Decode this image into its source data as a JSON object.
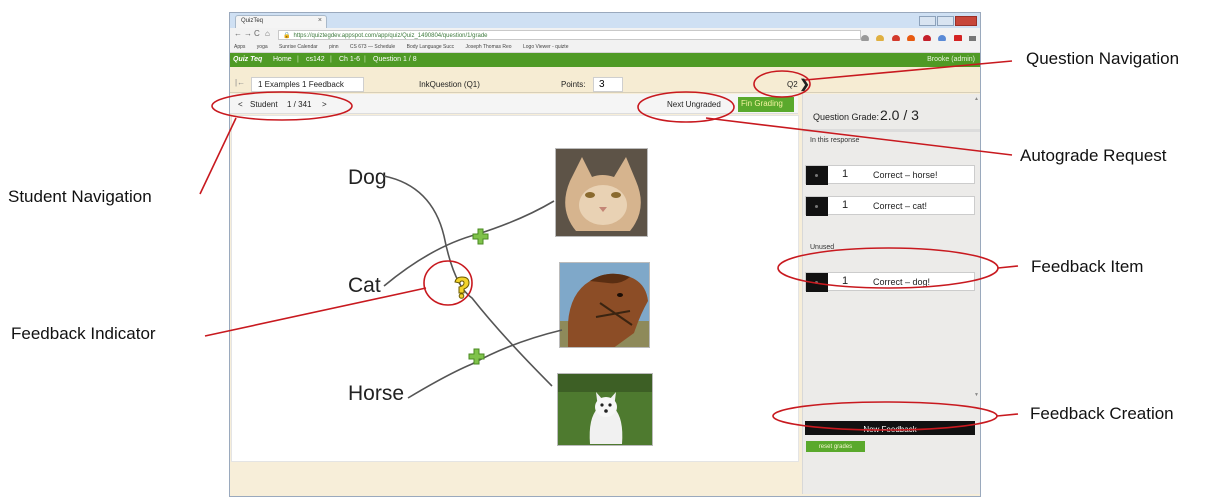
{
  "browser": {
    "tab_title": "QuizTeq",
    "tab_close": "×",
    "url": "https://quiztegdev.appspot.com/app/quiz/Quiz_1490804/question/1/grade",
    "bookmarks": [
      "Apps",
      "yoga",
      "Sunrise Calendar",
      "pinn",
      "CS 673 — Schedule",
      "Body Language Succ",
      "Joseph Thomas Reo",
      "Logo Viewer - quizte"
    ]
  },
  "appbar": {
    "brand": "Quiz Teq",
    "links": [
      "Home",
      "cs142",
      "Ch 1-6",
      "Question 1 / 8"
    ],
    "user": "Brooke (admin)"
  },
  "question_bar": {
    "back": "|←",
    "examples_label": "1 Examples 1 Feedback",
    "question_title": "InkQuestion (Q1)",
    "points_label": "Points:",
    "points_value": "3",
    "next_question": "Q2",
    "next_arrow": "❯"
  },
  "student_nav": {
    "prev": "<",
    "label": "Student",
    "position": "1 / 341",
    "next": ">",
    "next_ungraded": "Next Ungraded",
    "finish_grading": "Fin Grading"
  },
  "canvas": {
    "words": [
      "Dog",
      "Cat",
      "Horse"
    ],
    "feedback_indicator": "?",
    "images": [
      "cat-photo",
      "horse-photo",
      "dog-photo"
    ]
  },
  "grade_panel": {
    "question_grade_label": "Question Grade:",
    "question_grade_value": "2.0 / 3",
    "in_response_label": "In this response",
    "in_response_items": [
      {
        "points": "1",
        "text": "Correct – horse!"
      },
      {
        "points": "1",
        "text": "Correct – cat!"
      }
    ],
    "unused_label": "Unused",
    "unused_items": [
      {
        "points": "1",
        "text": "Correct – dog!"
      }
    ],
    "new_feedback": "New Feedback",
    "reset_grades": "reset grades"
  },
  "annotations": {
    "question_navigation": "Question Navigation",
    "autograde_request": "Autograde Request",
    "student_navigation": "Student Navigation",
    "feedback_item": "Feedback Item",
    "feedback_indicator": "Feedback Indicator",
    "feedback_creation": "Feedback Creation"
  },
  "colors": {
    "appbar_green": "#4f9a25",
    "annotation_red": "#c8191f",
    "page_cream": "#f7eed9"
  }
}
